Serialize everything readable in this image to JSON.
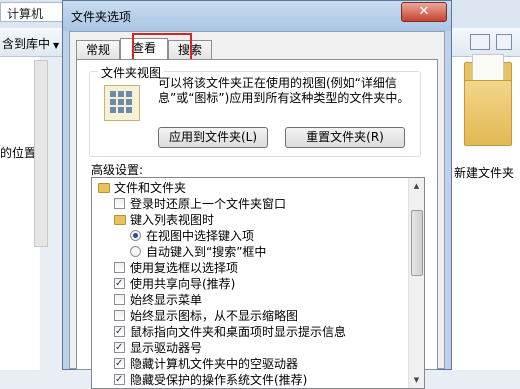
{
  "explorer": {
    "address_text": "计算机",
    "toolbar_library": "含到库中",
    "toolbar_library_arrow": "▼",
    "left_location": "的位置",
    "folder_label": "新建文件夹"
  },
  "dialog": {
    "title": "文件夹选项",
    "close_glyph": "✕",
    "tabs": [
      {
        "label": "常规",
        "active": false
      },
      {
        "label": "查看",
        "active": true
      },
      {
        "label": "搜索",
        "active": false
      }
    ],
    "folder_views": {
      "legend": "文件夹视图",
      "description": "可以将该文件夹正在使用的视图(例如“详细信息”或“图标”)应用到所有这种类型的文件夹中。",
      "apply_button": "应用到文件夹(L)",
      "reset_button": "重置文件夹(R)"
    },
    "advanced_label": "高级设置:",
    "advanced_items": [
      {
        "type": "folder",
        "label": "文件和文件夹",
        "indent": 0
      },
      {
        "type": "checkbox",
        "label": "登录时还原上一个文件夹窗口",
        "checked": false,
        "indent": 1
      },
      {
        "type": "folder",
        "label": "键入列表视图时",
        "indent": 1
      },
      {
        "type": "radio",
        "label": "在视图中选择键入项",
        "checked": true,
        "indent": 2
      },
      {
        "type": "radio",
        "label": "自动键入到“搜索”框中",
        "checked": false,
        "indent": 2
      },
      {
        "type": "checkbox",
        "label": "使用复选框以选择项",
        "checked": false,
        "indent": 1
      },
      {
        "type": "checkbox",
        "label": "使用共享向导(推荐)",
        "checked": true,
        "indent": 1
      },
      {
        "type": "checkbox",
        "label": "始终显示菜单",
        "checked": false,
        "indent": 1
      },
      {
        "type": "checkbox",
        "label": "始终显示图标，从不显示缩略图",
        "checked": false,
        "indent": 1
      },
      {
        "type": "checkbox",
        "label": "鼠标指向文件夹和桌面项时显示提示信息",
        "checked": true,
        "indent": 1
      },
      {
        "type": "checkbox",
        "label": "显示驱动器号",
        "checked": true,
        "indent": 1
      },
      {
        "type": "checkbox",
        "label": "隐藏计算机文件夹中的空驱动器",
        "checked": true,
        "indent": 1
      },
      {
        "type": "checkbox",
        "label": "隐藏受保护的操作系统文件(推荐)",
        "checked": true,
        "indent": 1
      }
    ]
  },
  "colors": {
    "highlight_box": "#d42626",
    "close_button": "#c8432f"
  }
}
